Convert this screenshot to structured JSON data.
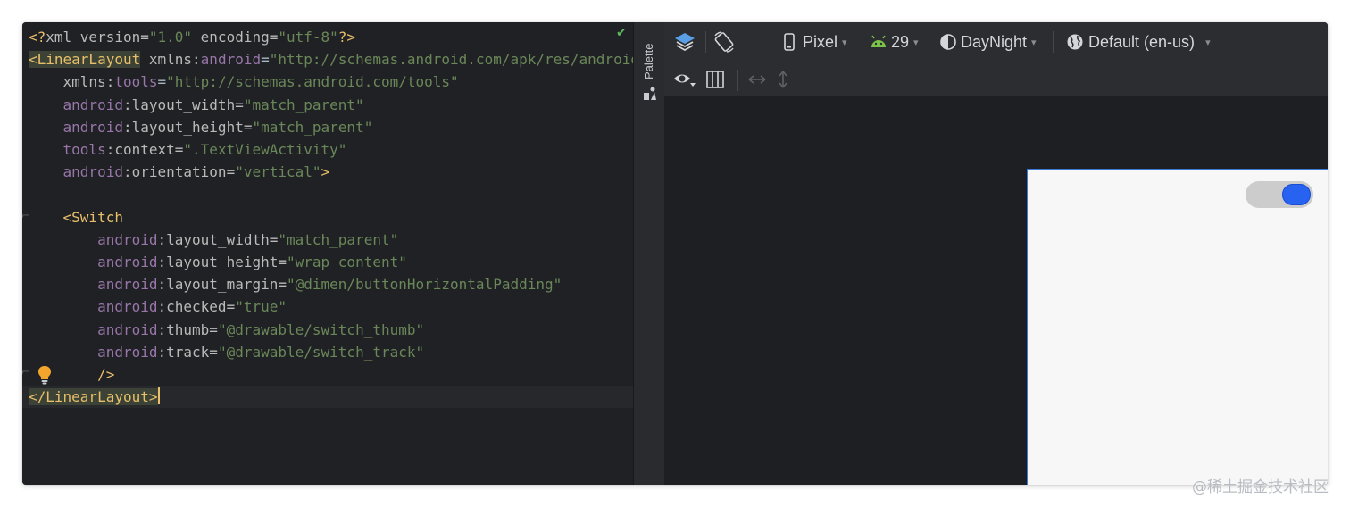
{
  "editor": {
    "lines": [
      [
        {
          "c": "t-pun",
          "t": "<?"
        },
        {
          "c": "t-attr",
          "t": "xml version="
        },
        {
          "c": "t-str",
          "t": "\"1.0\""
        },
        {
          "c": "t-attr",
          "t": " encoding="
        },
        {
          "c": "t-str",
          "t": "\"utf-8\""
        },
        {
          "c": "t-pun",
          "t": "?>"
        }
      ],
      [
        {
          "c": "t-tag t-hl",
          "t": "<LinearLayout"
        },
        {
          "c": "t-attr",
          "t": " xmlns:"
        },
        {
          "c": "t-ns",
          "t": "android"
        },
        {
          "c": "t-eq",
          "t": "="
        },
        {
          "c": "t-str",
          "t": "\"http://schemas.android.com/apk/res/android\""
        }
      ],
      [
        {
          "c": "t-attr",
          "t": "    xmlns:"
        },
        {
          "c": "t-ns",
          "t": "tools"
        },
        {
          "c": "t-eq",
          "t": "="
        },
        {
          "c": "t-str",
          "t": "\"http://schemas.android.com/tools\""
        }
      ],
      [
        {
          "c": "t-ns",
          "t": "    android"
        },
        {
          "c": "t-attr",
          "t": ":layout_width="
        },
        {
          "c": "t-str",
          "t": "\"match_parent\""
        }
      ],
      [
        {
          "c": "t-ns",
          "t": "    android"
        },
        {
          "c": "t-attr",
          "t": ":layout_height="
        },
        {
          "c": "t-str",
          "t": "\"match_parent\""
        }
      ],
      [
        {
          "c": "t-ns",
          "t": "    tools"
        },
        {
          "c": "t-attr",
          "t": ":context="
        },
        {
          "c": "t-str",
          "t": "\".TextViewActivity\""
        }
      ],
      [
        {
          "c": "t-ns",
          "t": "    android"
        },
        {
          "c": "t-attr",
          "t": ":orientation="
        },
        {
          "c": "t-str",
          "t": "\"vertical\""
        },
        {
          "c": "t-pun",
          "t": ">"
        }
      ],
      [],
      [
        {
          "c": "t-tag",
          "t": "    <Switch"
        }
      ],
      [
        {
          "c": "t-ns",
          "t": "        android"
        },
        {
          "c": "t-attr",
          "t": ":layout_width="
        },
        {
          "c": "t-str",
          "t": "\"match_parent\""
        }
      ],
      [
        {
          "c": "t-ns",
          "t": "        android"
        },
        {
          "c": "t-attr",
          "t": ":layout_height="
        },
        {
          "c": "t-str",
          "t": "\"wrap_content\""
        }
      ],
      [
        {
          "c": "t-ns",
          "t": "        android"
        },
        {
          "c": "t-attr",
          "t": ":layout_margin="
        },
        {
          "c": "t-str",
          "t": "\"@dimen/buttonHorizontalPadding\""
        }
      ],
      [
        {
          "c": "t-ns",
          "t": "        android"
        },
        {
          "c": "t-attr",
          "t": ":checked="
        },
        {
          "c": "t-str",
          "t": "\"true\""
        }
      ],
      [
        {
          "c": "t-ns",
          "t": "        android"
        },
        {
          "c": "t-attr",
          "t": ":thumb="
        },
        {
          "c": "t-str",
          "t": "\"@drawable/switch_thumb\""
        }
      ],
      [
        {
          "c": "t-ns",
          "t": "        android"
        },
        {
          "c": "t-attr",
          "t": ":track="
        },
        {
          "c": "t-str",
          "t": "\"@drawable/switch_track\""
        }
      ],
      [
        {
          "c": "t-tag",
          "t": "        />"
        }
      ],
      [
        {
          "c": "t-tag t-hl",
          "t": "</LinearLayout>"
        }
      ]
    ]
  },
  "palette": {
    "label": "Palette"
  },
  "toolbar": {
    "device": "Pixel",
    "api_level": "29",
    "theme": "DayNight",
    "locale": "Default (en-us)"
  },
  "preview": {
    "switch_checked": true,
    "thumb_color": "#2762f0",
    "track_color": "#cccccc"
  },
  "watermark": "@稀土掘金技术社区",
  "colors": {
    "accent": "#3b7bd8",
    "android_green": "#7cc349"
  }
}
